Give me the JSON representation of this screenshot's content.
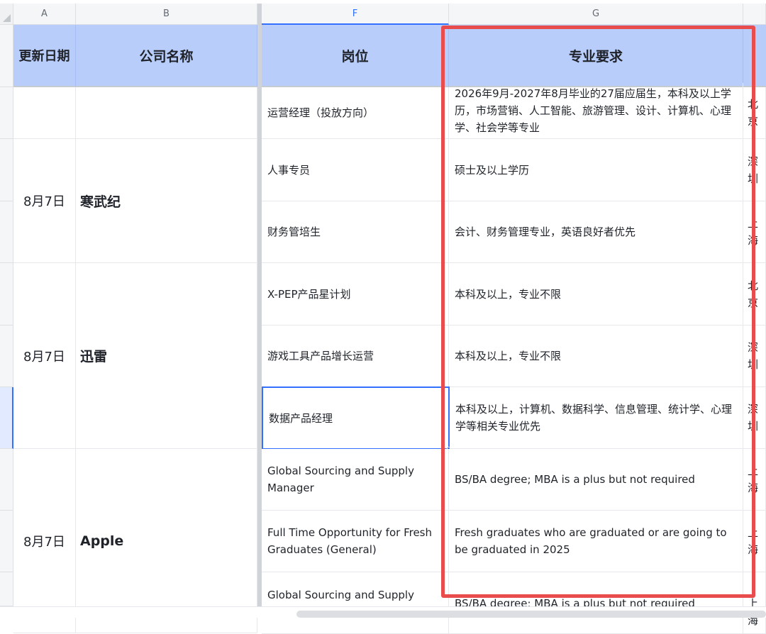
{
  "column_headers": [
    "A",
    "B",
    "F",
    "G"
  ],
  "table_headers": {
    "date": "更新日期",
    "company": "公司名称",
    "position": "岗位",
    "major": "专业要求"
  },
  "groups": [
    {
      "date": "8月7日",
      "company": "寒武纪"
    },
    {
      "date": "8月7日",
      "company": "迅雷"
    },
    {
      "date": "8月7日",
      "company": "Apple"
    }
  ],
  "rows": [
    {
      "position": "运营经理（投放方向）",
      "major": "2026年9月-2027年8月毕业的27届应届生，本科及以上学历，市场营销、人工智能、旅游管理、设计、计算机、心理学、社会学等专业",
      "location": "北京"
    },
    {
      "position": "人事专员",
      "major": "硕士及以上学历",
      "location": "深圳"
    },
    {
      "position": "财务管培生",
      "major": "会计、财务管理专业，英语良好者优先",
      "location": "上海"
    },
    {
      "position": "X-PEP产品星计划",
      "major": "本科及以上，专业不限",
      "location": "北京"
    },
    {
      "position": "游戏工具产品增长运营",
      "major": "本科及以上，专业不限",
      "location": "深圳"
    },
    {
      "position": "数据产品经理",
      "major": "本科及以上，计算机、数据科学、信息管理、统计学、心理学等相关专业优先",
      "location": "深圳"
    },
    {
      "position": "Global Sourcing and Supply Manager",
      "major": "BS/BA degree; MBA is a plus but not required",
      "location": "上海"
    },
    {
      "position": "Full Time Opportunity for Fresh Graduates (General)",
      "major": "Fresh graduates who are graduated or are going to be graduated in 2025",
      "location": "上海"
    },
    {
      "position": "Global Sourcing and Supply",
      "major": "BS/BA degree; MBA is a plus but not required",
      "location": "上海"
    }
  ],
  "colors": {
    "header_bg": "#b9cdfb",
    "highlight_border": "#e84c4c",
    "selection_border": "#3370ff"
  }
}
